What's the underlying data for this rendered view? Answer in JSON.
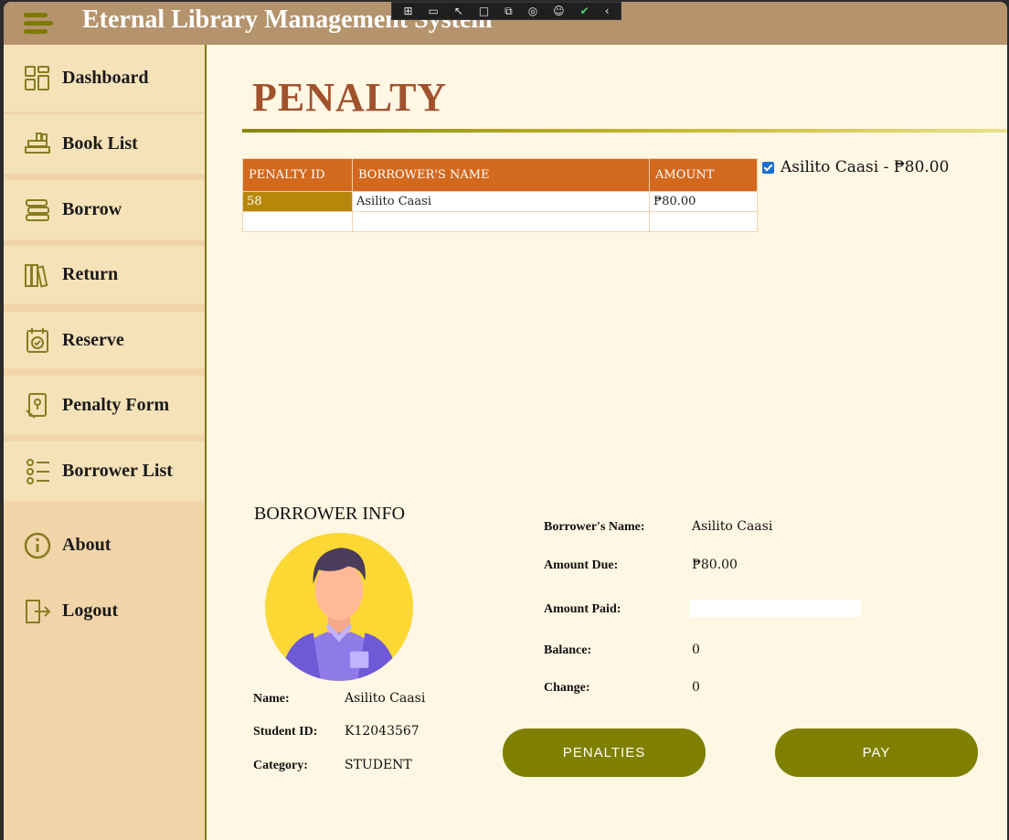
{
  "app": {
    "title": "Eternal Library Management System"
  },
  "devtools": {
    "icons": [
      "live-tree-icon",
      "record-icon",
      "select-icon",
      "frame-icon",
      "track-focus-icon",
      "hot-reload-icon",
      "accessibility-icon",
      "check-icon",
      "collapse-icon"
    ]
  },
  "sidebar": {
    "items": [
      {
        "label": "Dashboard",
        "icon": "dashboard-icon"
      },
      {
        "label": "Book List",
        "icon": "books-icon"
      },
      {
        "label": "Borrow",
        "icon": "book-stack-icon"
      },
      {
        "label": "Return",
        "icon": "book-shelf-icon"
      },
      {
        "label": "Reserve",
        "icon": "reserve-icon"
      },
      {
        "label": "Penalty Form",
        "icon": "penalty-icon"
      },
      {
        "label": "Borrower List",
        "icon": "borrower-list-icon"
      },
      {
        "label": "About",
        "icon": "info-icon"
      },
      {
        "label": "Logout",
        "icon": "logout-icon"
      }
    ]
  },
  "page": {
    "title": "PENALTY"
  },
  "table": {
    "headers": [
      "PENALTY ID",
      "BORROWER'S NAME",
      "AMOUNT"
    ],
    "rows": [
      {
        "id": "58",
        "name": "Asilito Caasi",
        "amount": "₱80.00"
      }
    ]
  },
  "selection": {
    "label": "Asilito Caasi - ₱80.00",
    "checked": true
  },
  "borrower_info": {
    "title": "BORROWER INFO",
    "name_label": "Name:",
    "name": "Asilito Caasi",
    "student_id_label": "Student ID:",
    "student_id": "K12043567",
    "category_label": "Category:",
    "category": "STUDENT"
  },
  "payment": {
    "borrower_name_label": "Borrower's Name:",
    "borrower_name": "Asilito Caasi",
    "amount_due_label": "Amount Due:",
    "amount_due": "₱80.00",
    "amount_paid_label": "Amount Paid:",
    "amount_paid": "",
    "balance_label": "Balance:",
    "balance": "0",
    "change_label": "Change:",
    "change": "0"
  },
  "buttons": {
    "penalties": "PENALTIES",
    "pay": "PAY"
  },
  "colors": {
    "titlebar": "#b5936c",
    "accent": "#808000",
    "header": "#d2691e",
    "title": "#a0522d",
    "sidebar": "#f1d5a9",
    "content": "#fff7e3"
  }
}
